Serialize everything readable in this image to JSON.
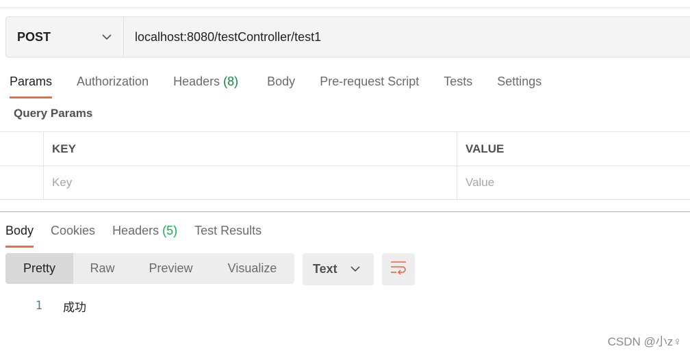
{
  "request": {
    "method": "POST",
    "url": "localhost:8080/testController/test1"
  },
  "request_tabs": [
    {
      "label": "Params"
    },
    {
      "label": "Authorization"
    },
    {
      "label": "Headers",
      "count": "(8)"
    },
    {
      "label": "Body"
    },
    {
      "label": "Pre-request Script"
    },
    {
      "label": "Tests"
    },
    {
      "label": "Settings"
    }
  ],
  "query_params": {
    "title": "Query Params",
    "key_header": "KEY",
    "value_header": "VALUE",
    "key_placeholder": "Key",
    "value_placeholder": "Value"
  },
  "response_tabs": [
    {
      "label": "Body"
    },
    {
      "label": "Cookies"
    },
    {
      "label": "Headers",
      "count": "(5)"
    },
    {
      "label": "Test Results"
    }
  ],
  "format_tabs": [
    "Pretty",
    "Raw",
    "Preview",
    "Visualize"
  ],
  "format_selector": "Text",
  "response_body": {
    "line_number": "1",
    "line_text": "成功"
  },
  "watermark": "CSDN @小z♀",
  "colors": {
    "accent": "#f26b3a",
    "count": "#0a8a3c",
    "count_response": "#0cb34c"
  },
  "icons": [
    "chevron-down-icon",
    "word-wrap-icon"
  ]
}
